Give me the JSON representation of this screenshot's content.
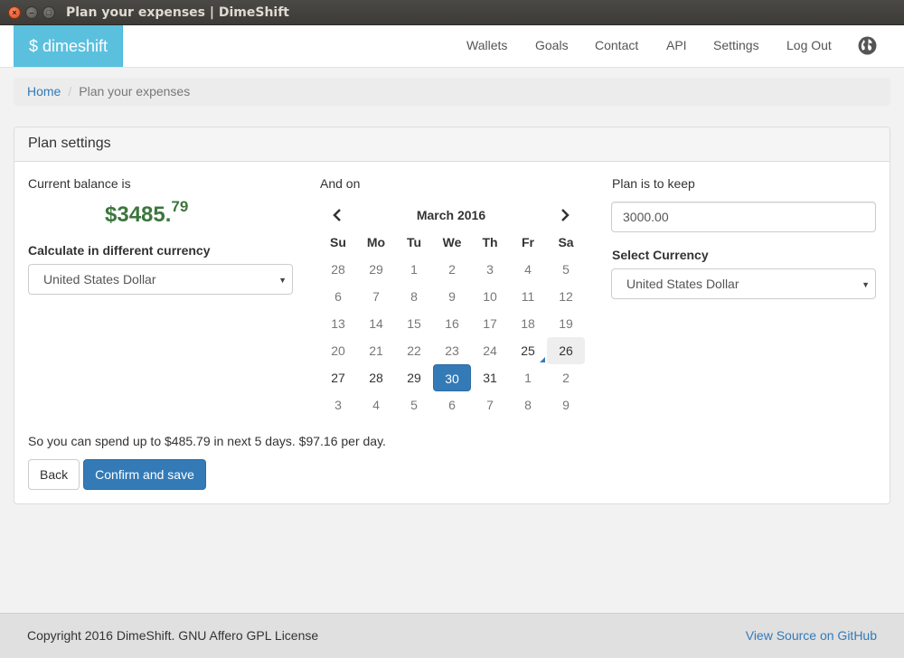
{
  "window": {
    "title": "Plan your expenses | DimeShift",
    "controls": [
      "close-icon",
      "minimize-icon",
      "maximize-icon"
    ]
  },
  "navbar": {
    "brand": "$ dimeshift",
    "links": [
      "Wallets",
      "Goals",
      "Contact",
      "API",
      "Settings",
      "Log Out"
    ],
    "language_icon": "globe-icon"
  },
  "breadcrumb": {
    "home": "Home",
    "separator": "/",
    "current": "Plan your expenses"
  },
  "panel": {
    "heading": "Plan settings",
    "balance": {
      "label": "Current balance is",
      "whole": "$3485.",
      "cents": "79"
    },
    "calc_currency": {
      "label": "Calculate in different currency",
      "selected": "United States Dollar"
    },
    "date": {
      "label": "And on"
    },
    "keep": {
      "label": "Plan is to keep",
      "value": "3000.00"
    },
    "currency": {
      "label": "Select Currency",
      "selected": "United States Dollar"
    },
    "summary": "So you can spend up to $485.79 in next 5 days. $97.16 per day.",
    "buttons": {
      "back": "Back",
      "confirm": "Confirm and save"
    }
  },
  "calendar": {
    "title": "March 2016",
    "prev_icon": "chevron-left-icon",
    "next_icon": "chevron-right-icon",
    "weekdays": [
      "Su",
      "Mo",
      "Tu",
      "We",
      "Th",
      "Fr",
      "Sa"
    ],
    "weeks": [
      [
        {
          "d": "28",
          "s": "muted"
        },
        {
          "d": "29",
          "s": "muted"
        },
        {
          "d": "1",
          "s": "muted"
        },
        {
          "d": "2",
          "s": "muted"
        },
        {
          "d": "3",
          "s": "muted"
        },
        {
          "d": "4",
          "s": "muted"
        },
        {
          "d": "5",
          "s": "muted"
        }
      ],
      [
        {
          "d": "6",
          "s": "muted"
        },
        {
          "d": "7",
          "s": "muted"
        },
        {
          "d": "8",
          "s": "muted"
        },
        {
          "d": "9",
          "s": "muted"
        },
        {
          "d": "10",
          "s": "muted"
        },
        {
          "d": "11",
          "s": "muted"
        },
        {
          "d": "12",
          "s": "muted"
        }
      ],
      [
        {
          "d": "13",
          "s": "muted"
        },
        {
          "d": "14",
          "s": "muted"
        },
        {
          "d": "15",
          "s": "muted"
        },
        {
          "d": "16",
          "s": "muted"
        },
        {
          "d": "17",
          "s": "muted"
        },
        {
          "d": "18",
          "s": "muted"
        },
        {
          "d": "19",
          "s": "muted"
        }
      ],
      [
        {
          "d": "20",
          "s": "muted"
        },
        {
          "d": "21",
          "s": "muted"
        },
        {
          "d": "22",
          "s": "muted"
        },
        {
          "d": "23",
          "s": "muted"
        },
        {
          "d": "24",
          "s": "muted"
        },
        {
          "d": "25",
          "s": "today"
        },
        {
          "d": "26",
          "s": "hover"
        }
      ],
      [
        {
          "d": "27",
          "s": "normal"
        },
        {
          "d": "28",
          "s": "normal"
        },
        {
          "d": "29",
          "s": "normal"
        },
        {
          "d": "30",
          "s": "active"
        },
        {
          "d": "31",
          "s": "normal"
        },
        {
          "d": "1",
          "s": "muted"
        },
        {
          "d": "2",
          "s": "muted"
        }
      ],
      [
        {
          "d": "3",
          "s": "muted"
        },
        {
          "d": "4",
          "s": "muted"
        },
        {
          "d": "5",
          "s": "muted"
        },
        {
          "d": "6",
          "s": "muted"
        },
        {
          "d": "7",
          "s": "muted"
        },
        {
          "d": "8",
          "s": "muted"
        },
        {
          "d": "9",
          "s": "muted"
        }
      ]
    ]
  },
  "footer": {
    "copyright": "Copyright 2016 DimeShift. GNU Affero GPL License",
    "source_link": "View Source on GitHub"
  },
  "colors": {
    "brand": "#5bc0de",
    "primary": "#337ab7",
    "balance": "#3c763d",
    "titlebar": "#3c3b37"
  }
}
